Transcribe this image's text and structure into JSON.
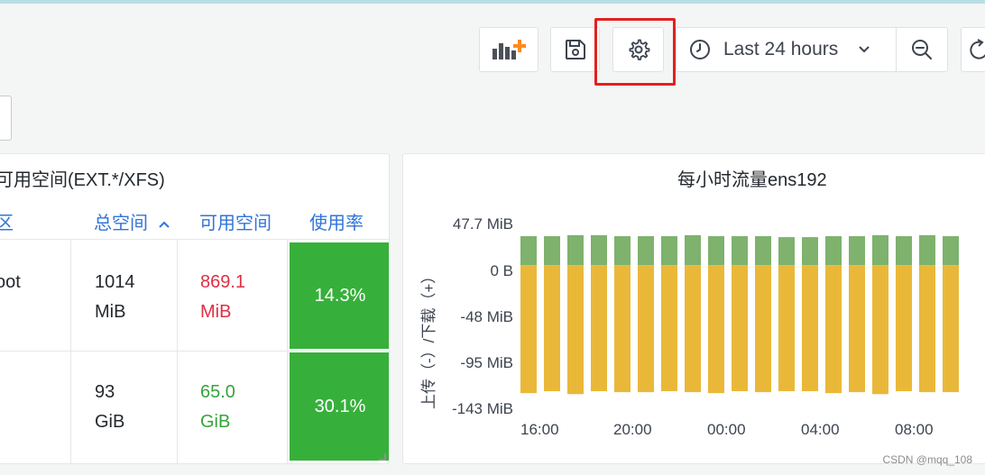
{
  "toolbar": {
    "add_panel_icon": "add-panel-icon",
    "save_icon": "save-icon",
    "settings_icon": "gear-icon",
    "time_range": "Last 24 hours",
    "zoom_icon": "zoom-out-icon",
    "refresh_icon": "refresh-icon"
  },
  "disk_panel": {
    "title": "可用空间(EXT.*/XFS)",
    "columns": [
      "区",
      "总空间",
      "可用空间",
      "使用率"
    ],
    "sort_indicator": "^",
    "rows": [
      {
        "partition": "oot",
        "total_1": "1014",
        "total_2": "MiB",
        "free_1": "869.1",
        "free_2": "MiB",
        "usage": "14.3%"
      },
      {
        "partition": "",
        "total_1": "93",
        "total_2": "GiB",
        "free_1": "65.0",
        "free_2": "GiB",
        "usage": "30.1%"
      }
    ],
    "colors": {
      "free_row1": "#e02f44",
      "free_row2": "#37a33b",
      "usage_bg": "#37b03b"
    }
  },
  "traffic_panel": {
    "title": "每小时流量ens192"
  },
  "chart_data": {
    "type": "bar",
    "title": "每小时流量ens192",
    "ylabel": "上传（-）/下载（+）",
    "yticks": [
      "47.7 MiB",
      "0 B",
      "-48 MiB",
      "-95 MiB",
      "-143 MiB"
    ],
    "xticks": [
      "16:00",
      "20:00",
      "00:00",
      "04:00",
      "08:00"
    ],
    "ylim": [
      -143,
      47.7
    ],
    "units": "MiB",
    "series": [
      {
        "color": "#7eb26d",
        "values": [
          30,
          30,
          31,
          31,
          30,
          30,
          30,
          31,
          30,
          30,
          30,
          29,
          29,
          30,
          30,
          31,
          30,
          31,
          30
        ]
      },
      {
        "color": "#eab839",
        "values": [
          -132,
          -130,
          -133,
          -130,
          -131,
          -131,
          -130,
          -131,
          -132,
          -130,
          -131,
          -130,
          -130,
          -132,
          -131,
          -133,
          -130,
          -131,
          -131
        ]
      }
    ],
    "legend": "none"
  },
  "watermark": "CSDN @mqq_108"
}
